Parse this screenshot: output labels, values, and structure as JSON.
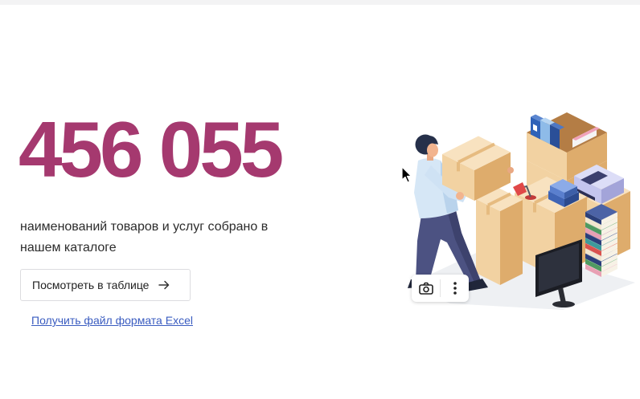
{
  "theme": {
    "accent": "#a5396f",
    "link": "#3a5cc0"
  },
  "stat": {
    "value": "456 055",
    "description": "наименований товаров и услуг собрано в нашем каталоге"
  },
  "actions": {
    "view_table": {
      "label": "Посмотреть в таблице",
      "icon": "arrow-right-icon"
    },
    "excel_link": {
      "label": "Получить файл формата Excel"
    }
  },
  "image_toolbar": {
    "buttons": [
      {
        "icon": "camera-icon"
      },
      {
        "icon": "more-vertical-icon"
      }
    ]
  },
  "cursor": {
    "icon": "mouse-pointer-icon"
  }
}
